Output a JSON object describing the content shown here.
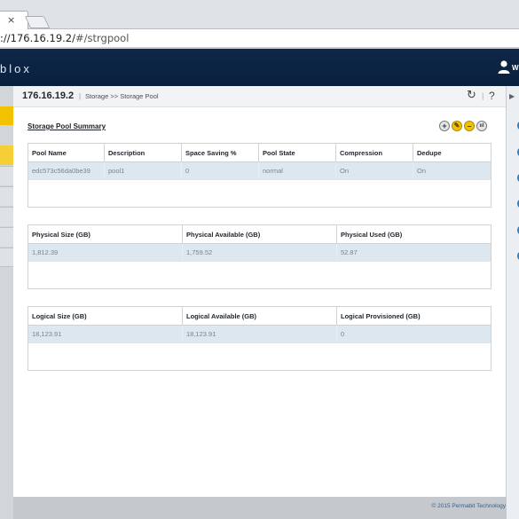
{
  "browser": {
    "tab_close": "×",
    "url_host": "://176.16.19.2/",
    "url_path": "#/strgpool"
  },
  "header": {
    "brand": "blox",
    "user_label": "W"
  },
  "breadcrumb": {
    "ip": "176.16.19.2",
    "separator": "|",
    "path": "Storage >> Storage Pool",
    "divider": "|",
    "help": "?",
    "refresh": "↻"
  },
  "summary": {
    "title": "Storage Pool Summary",
    "actions": {
      "add": "+",
      "edit": "✎",
      "remove": "–",
      "stats": "ııl"
    }
  },
  "pool_table": {
    "headers": [
      "Pool Name",
      "Description",
      "Space Saving %",
      "Pool State",
      "Compression",
      "Dedupe"
    ],
    "row": [
      "edc573c56da0be39",
      "pool1",
      "0",
      "normal",
      "On",
      "On"
    ]
  },
  "physical_table": {
    "headers": [
      "Physical Size (GB)",
      "Physical Available (GB)",
      "Physical Used (GB)"
    ],
    "row": [
      "1,812.39",
      "1,759.52",
      "52.87"
    ]
  },
  "logical_table": {
    "headers": [
      "Logical Size (GB)",
      "Logical Available (GB)",
      "Logical Provisioned (GB)"
    ],
    "row": [
      "18,123.91",
      "18,123.91",
      "0"
    ]
  },
  "footer": {
    "copyright": "© 2015 Permabit Technology"
  },
  "rail": {
    "arrow": "▶"
  },
  "colors": {
    "header_bg": "#0f2748",
    "accent": "#f2c200",
    "row_bg": "#dde7f0",
    "link": "#2e7fc4"
  }
}
